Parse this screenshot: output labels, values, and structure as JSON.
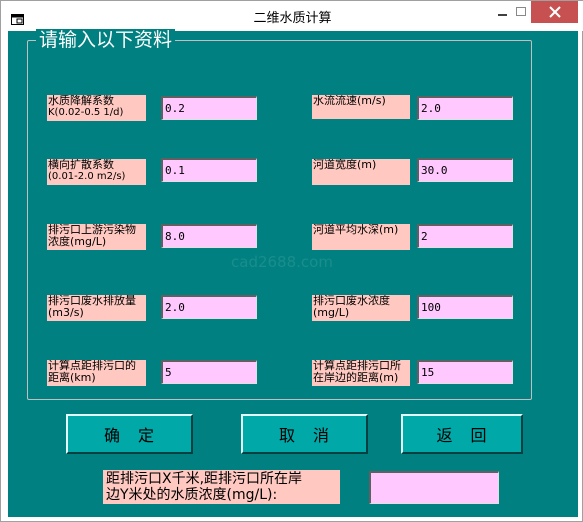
{
  "window": {
    "title": "二维水质计算"
  },
  "group": {
    "title": "请输入以下资料"
  },
  "fields": [
    {
      "label_line1": "水质降解系数",
      "label_line2": "K(0.02-0.5 1/d)",
      "value": "0.2"
    },
    {
      "label_line1": "横向扩散系数",
      "label_line2": "(0.01-2.0 m2/s)",
      "value": "0.1"
    },
    {
      "label_line1": "排污口上游污染物",
      "label_line2": "浓度(mg/L)",
      "value": "8.0"
    },
    {
      "label_line1": "排污口废水排放量",
      "label_line2": "(m3/s)",
      "value": "2.0"
    },
    {
      "label_line1": "计算点距排污口的",
      "label_line2": "距离(km)",
      "value": "5"
    },
    {
      "label_line1": "水流流速(m/s)",
      "label_line2": "",
      "value": "2.0"
    },
    {
      "label_line1": "河道宽度(m)",
      "label_line2": "",
      "value": "30.0"
    },
    {
      "label_line1": "河道平均水深(m)",
      "label_line2": "",
      "value": "2"
    },
    {
      "label_line1": "排污口废水浓度",
      "label_line2": "(mg/L)",
      "value": "100"
    },
    {
      "label_line1": "计算点距排污口所",
      "label_line2": "在岸边的距离(m)",
      "value": "15"
    }
  ],
  "buttons": {
    "confirm": "确　定",
    "cancel": "取　消",
    "back": "返　回"
  },
  "result": {
    "label_line1": "距排污口X千米,距排污口所在岸",
    "label_line2": "边Y米处的水质浓度(mg/L):",
    "value": ""
  },
  "watermark": "cad2688.com",
  "colors": {
    "background": "#008080",
    "label_bg": "#ffc8c0",
    "input_bg": "#ffc8ff",
    "button_bg": "#00a8a8"
  }
}
